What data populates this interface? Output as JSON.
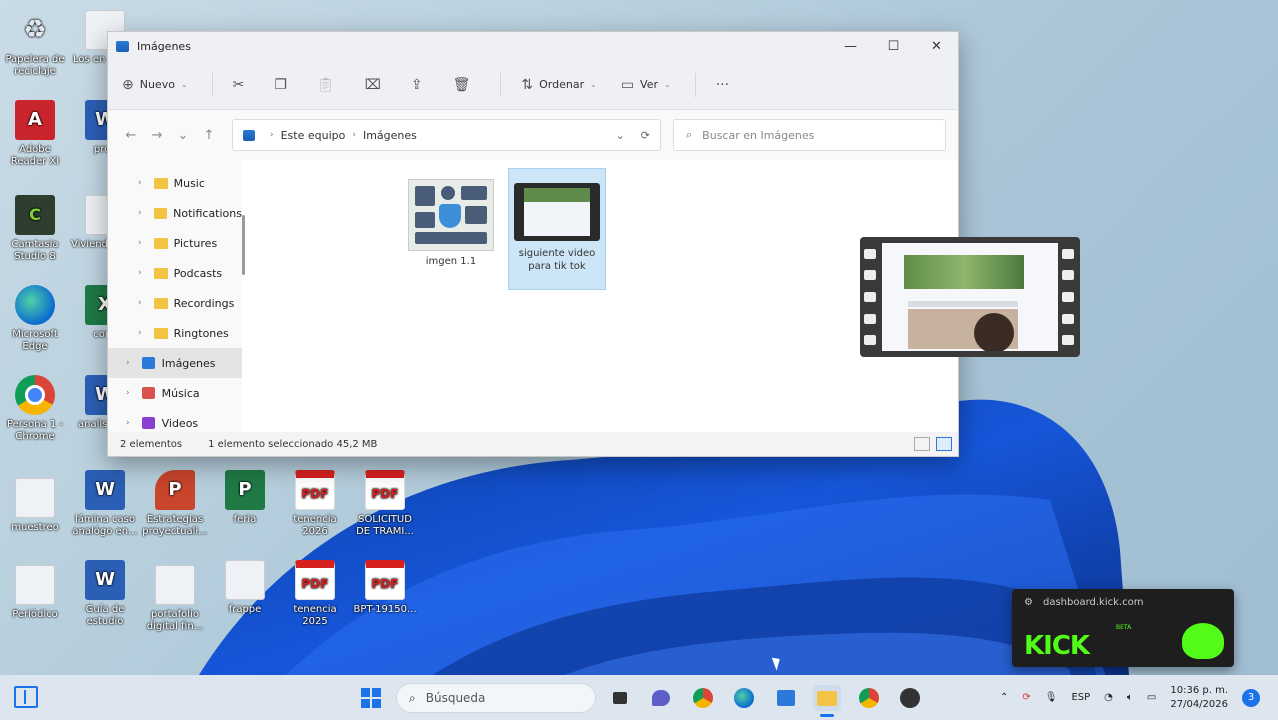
{
  "desktop": {
    "icons": [
      {
        "label": "Papelera de reciclaje",
        "glyph": "♻",
        "kind": "recycle"
      },
      {
        "label": "Los en y Ben",
        "glyph": "",
        "kind": "gen"
      },
      {
        "label": "Adobe Reader XI",
        "glyph": "A",
        "kind": "acrobat"
      },
      {
        "label": "proy",
        "glyph": "W",
        "kind": "word"
      },
      {
        "label": "Camtasia Studio 8",
        "glyph": "C",
        "kind": "camtasia"
      },
      {
        "label": "Viviend perso",
        "glyph": "",
        "kind": "gen"
      },
      {
        "label": "Microsoft Edge",
        "glyph": "",
        "kind": "edge"
      },
      {
        "label": "conc",
        "glyph": "X",
        "kind": "excel"
      },
      {
        "label": "Persona 1 - Chrome",
        "glyph": "",
        "kind": "chrome"
      },
      {
        "label": "analis anal",
        "glyph": "W",
        "kind": "word"
      },
      {
        "label": "muestreo",
        "glyph": "",
        "kind": "gen"
      },
      {
        "label": "lámina caso analógo en...",
        "glyph": "W",
        "kind": "word"
      },
      {
        "label": "Estrategias proyectuali...",
        "glyph": "P",
        "kind": "ppt"
      },
      {
        "label": "feria",
        "glyph": "P",
        "kind": "proj"
      },
      {
        "label": "tenencia 2026",
        "glyph": "PDF",
        "kind": "pdf"
      },
      {
        "label": "SOLICITUD DE TRAMI...",
        "glyph": "PDF",
        "kind": "pdf"
      },
      {
        "label": "Periódico",
        "glyph": "",
        "kind": "gen"
      },
      {
        "label": "Guía de estudio",
        "glyph": "W",
        "kind": "word"
      },
      {
        "label": "portafolio digital fin...",
        "glyph": "",
        "kind": "gen"
      },
      {
        "label": "frappe",
        "glyph": "",
        "kind": "gen"
      },
      {
        "label": "tenencia 2025",
        "glyph": "PDF",
        "kind": "pdf"
      },
      {
        "label": "BPT-19150...",
        "glyph": "PDF",
        "kind": "pdf"
      }
    ]
  },
  "explorer": {
    "title": "Imágenes",
    "window_buttons": {
      "minimize": "—",
      "maximize": "☐",
      "close": "✕"
    },
    "toolbar": {
      "new_label": "Nuevo",
      "sort_label": "Ordenar",
      "view_label": "Ver",
      "more": "···"
    },
    "nav": {
      "back": "←",
      "forward": "→",
      "recent": "⌄",
      "up": "↑"
    },
    "address": {
      "segments": [
        "Este equipo",
        "Imágenes"
      ],
      "separator": "›"
    },
    "search_placeholder": "Buscar en Imágenes",
    "sidebar": [
      {
        "label": "Music",
        "kind": "folder"
      },
      {
        "label": "Notifications",
        "kind": "folder"
      },
      {
        "label": "Pictures",
        "kind": "folder"
      },
      {
        "label": "Podcasts",
        "kind": "folder"
      },
      {
        "label": "Recordings",
        "kind": "folder"
      },
      {
        "label": "Ringtones",
        "kind": "folder"
      },
      {
        "label": "Imágenes",
        "kind": "lib",
        "selected": true,
        "color": "#2b79d8"
      },
      {
        "label": "Música",
        "kind": "lib",
        "color": "#d9534f"
      },
      {
        "label": "Videos",
        "kind": "lib",
        "color": "#8a3fd1"
      }
    ],
    "files": [
      {
        "name": "imgen 1.1",
        "type": "image",
        "selected": false
      },
      {
        "name": "siguiente video para tik tok",
        "type": "video",
        "selected": true
      }
    ],
    "status": {
      "count": "2 elementos",
      "selection": "1 elemento seleccionado  45,2 MB"
    }
  },
  "toast": {
    "source": "dashboard.kick.com",
    "brand": "KICK",
    "badge": "BETA",
    "accent": "#53fc18"
  },
  "taskbar": {
    "search_placeholder": "Búsqueda",
    "language": "ESP",
    "time": "10:36 p. m.",
    "date": "27/04/2026",
    "notifications": "3",
    "accent": "#1a73e8"
  }
}
